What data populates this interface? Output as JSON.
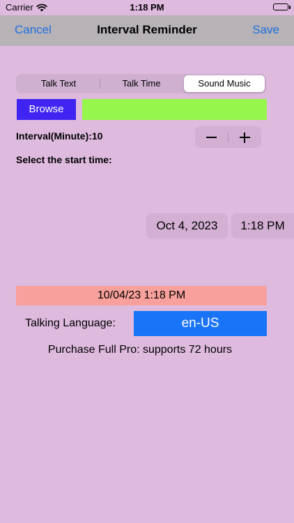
{
  "status_bar": {
    "carrier": "Carrier",
    "time": "1:18 PM",
    "icons": [
      "wifi-icon",
      "battery-icon"
    ]
  },
  "nav": {
    "cancel_label": "Cancel",
    "title": "Interval Reminder",
    "save_label": "Save",
    "accent_color": "#1f6fe0"
  },
  "segments": {
    "items": [
      "Talk Text",
      "Talk Time",
      "Sound Music"
    ],
    "selected": "Sound Music"
  },
  "browse": {
    "label": "Browse",
    "color": "#3f24f2",
    "field_color": "#96f64c"
  },
  "interval": {
    "label": "Interval(Minute):10",
    "stepper_icons": [
      "minus-icon",
      "plus-icon"
    ]
  },
  "start_time": {
    "label": "Select the start time:",
    "date": "Oct 4, 2023",
    "time": "1:18 PM"
  },
  "selected_datetime": {
    "value": "10/04/23 1:18 PM",
    "color": "#f8a09b"
  },
  "language": {
    "label": "Talking Language:",
    "value": "en-US",
    "color": "#1a74f7"
  },
  "purchase_text": "Purchase Full Pro: supports 72 hours",
  "colors": {
    "background": "#debade",
    "navbar": "#b7b2b6"
  }
}
